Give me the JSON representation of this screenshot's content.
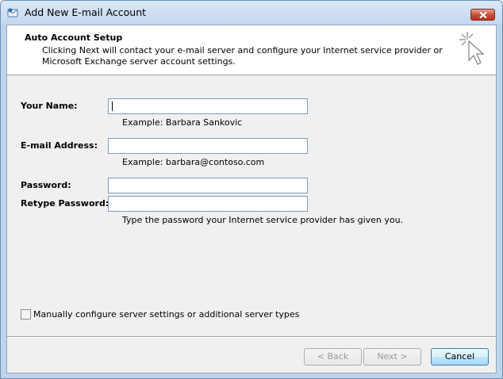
{
  "window": {
    "title": "Add New E-mail Account"
  },
  "header": {
    "title": "Auto Account Setup",
    "description": "Clicking Next will contact your e-mail server and configure your Internet service provider or Microsoft Exchange server account settings."
  },
  "form": {
    "name_label": "Your Name:",
    "name_value": "",
    "name_example": "Example: Barbara Sankovic",
    "email_label": "E-mail Address:",
    "email_value": "",
    "email_example": "Example: barbara@contoso.com",
    "password_label": "Password:",
    "password_value": "",
    "retype_label": "Retype Password:",
    "retype_value": "",
    "password_hint": "Type the password your Internet service provider has given you."
  },
  "manual_config": {
    "label": "Manually configure server settings or additional server types",
    "checked": false
  },
  "buttons": {
    "back": "< Back",
    "next": "Next >",
    "cancel": "Cancel"
  },
  "icons": {
    "title": "envelope-icon",
    "header": "wand-cursor-icon",
    "close": "close-icon"
  }
}
